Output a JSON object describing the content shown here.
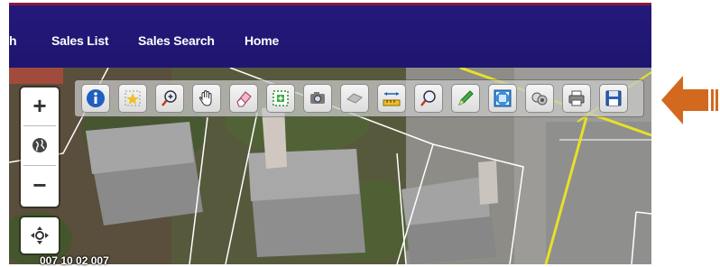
{
  "nav": {
    "partial_label": "h",
    "sales_list": "Sales List",
    "sales_search": "Sales Search",
    "home": "Home"
  },
  "map": {
    "parcel_label": "007 10 02 007"
  },
  "map_controls": {
    "zoom_in": "+",
    "zoom_out": "−"
  },
  "toolbar": {
    "tools": [
      "identify-icon",
      "select-icon",
      "zoom-in-area-icon",
      "pan-hand-icon",
      "eraser-icon",
      "select-region-icon",
      "camera-icon",
      "measure-icon",
      "distance-ruler-icon",
      "zoom-search-icon",
      "pencil-icon",
      "full-extent-icon",
      "layers-icon",
      "print-icon",
      "save-icon"
    ]
  },
  "colors": {
    "header_bg": "#1e1670",
    "header_border": "#8b1a3a",
    "arrow": "#d2691e",
    "parcel_line": "#ffffff",
    "road_line": "#e6e02a"
  }
}
